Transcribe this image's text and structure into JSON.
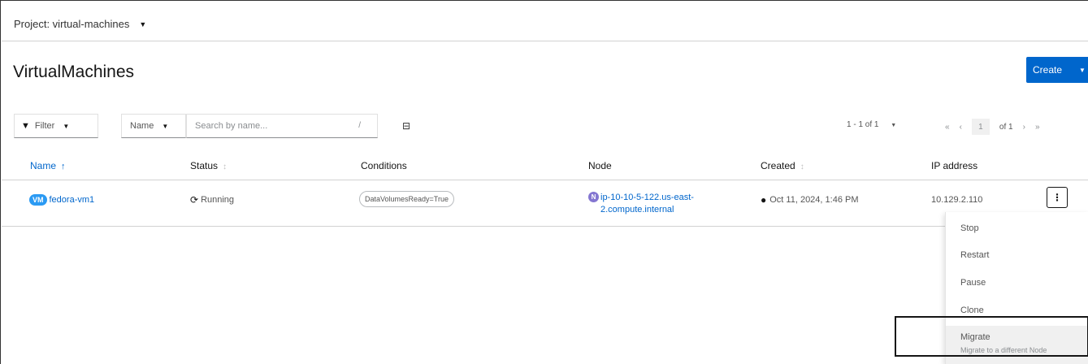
{
  "project": {
    "label": "Project: virtual-machines"
  },
  "page": {
    "title": "VirtualMachines",
    "create_label": "Create"
  },
  "toolbar": {
    "filter_label": "Filter",
    "search_by_label": "Name",
    "search_placeholder": "Search by name...",
    "search_shortcut": "/"
  },
  "pagination": {
    "count_label": "1 - 1 of 1",
    "current_page": "1",
    "of_label": "of 1"
  },
  "table": {
    "columns": [
      "Name",
      "Status",
      "Conditions",
      "Node",
      "Created",
      "IP address"
    ],
    "rows": [
      {
        "vm_badge": "VM",
        "name": "fedora-vm1",
        "status": "Running",
        "condition": "DataVolumesReady=True",
        "node_badge": "N",
        "node_line1": "ip-10-10-5-122.us-east-",
        "node_line2": "2.compute.internal",
        "created": "Oct 11, 2024, 1:46 PM",
        "ip": "10.129.2.110"
      }
    ]
  },
  "menu": {
    "items": [
      "Stop",
      "Restart",
      "Pause",
      "Clone",
      "Migrate"
    ],
    "migrate_description": "Migrate to a different Node"
  },
  "colors": {
    "accent": "#0066cc",
    "vm_badge": "#2b9af3",
    "node_badge": "#8476d1"
  },
  "icons": [
    "caret-down-icon",
    "filter-icon",
    "columns-icon",
    "sort-arrow-icon",
    "sync-icon",
    "globe-icon",
    "kebab-icon"
  ]
}
